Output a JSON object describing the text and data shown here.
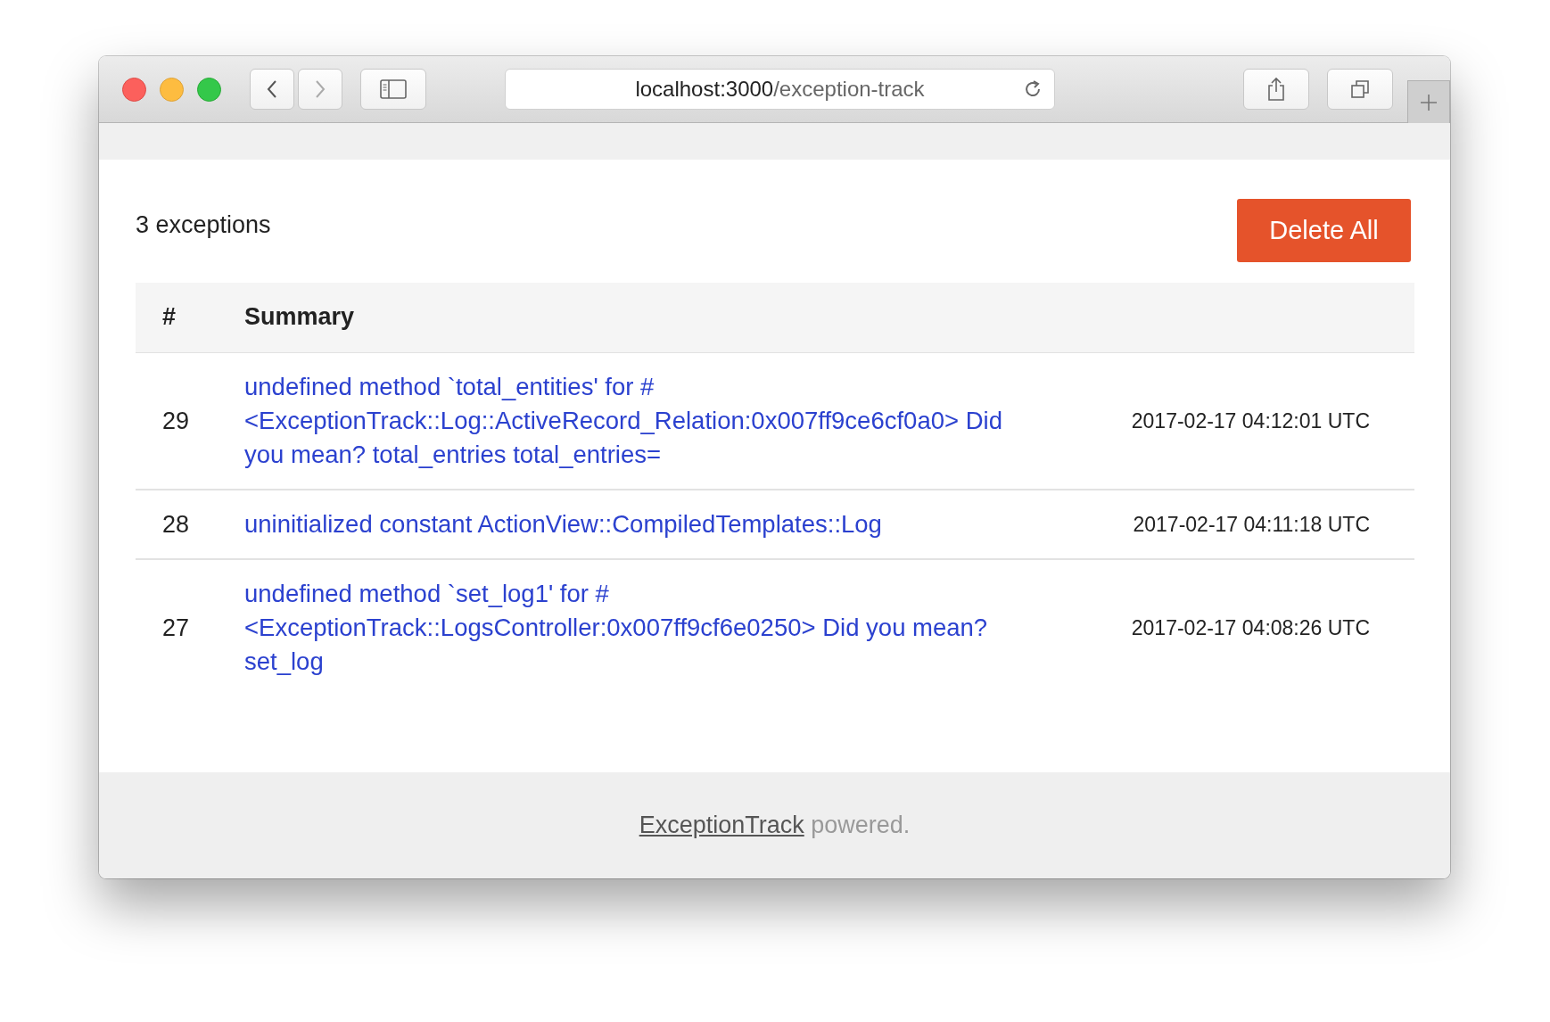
{
  "browser": {
    "url_host": "localhost:3000",
    "url_path": "/exception-track"
  },
  "header": {
    "count": "3 exceptions",
    "delete_button": "Delete All"
  },
  "table": {
    "columns": [
      "#",
      "Summary"
    ],
    "rows": [
      {
        "id": "29",
        "summary": "undefined method `total_entities' for #<ExceptionTrack::Log::ActiveRecord_Relation:0x007ff9ce6cf0a0> Did you mean? total_entries total_entries=",
        "time": "2017-02-17 04:12:01 UTC"
      },
      {
        "id": "28",
        "summary": "uninitialized constant ActionView::CompiledTemplates::Log",
        "time": "2017-02-17 04:11:18 UTC"
      },
      {
        "id": "27",
        "summary": "undefined method `set_log1' for #<ExceptionTrack::LogsController:0x007ff9cf6e0250> Did you mean? set_log",
        "time": "2017-02-17 04:08:26 UTC"
      }
    ]
  },
  "footer": {
    "link": "ExceptionTrack",
    "text": "powered."
  }
}
